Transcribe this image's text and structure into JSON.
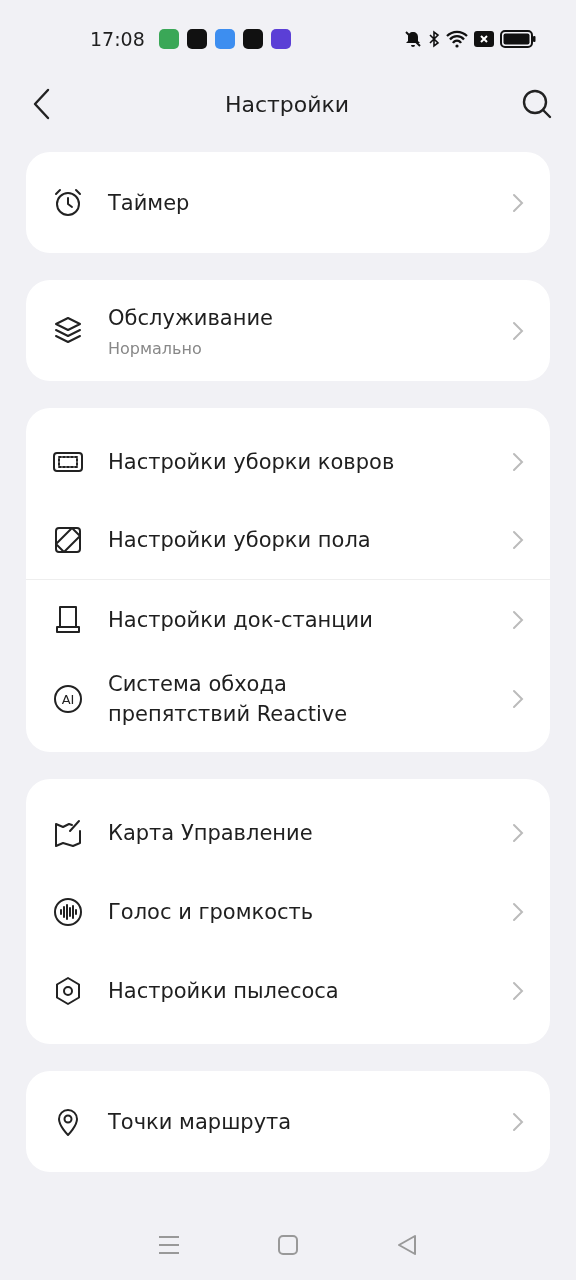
{
  "status_bar": {
    "time": "17:08",
    "app_icons": [
      {
        "color": "#3aa757"
      },
      {
        "color": "#111111"
      },
      {
        "color": "#3d8ef0"
      },
      {
        "color": "#111111"
      },
      {
        "color": "#5b3fd6"
      }
    ]
  },
  "header": {
    "title": "Настройки"
  },
  "groups": [
    {
      "items": [
        {
          "kind": "alarm",
          "label": "Таймер"
        }
      ]
    },
    {
      "items": [
        {
          "kind": "layers",
          "label": "Обслуживание",
          "subtitle": "Нормально"
        }
      ]
    },
    {
      "items": [
        {
          "kind": "carpet",
          "label": "Настройки уборки ковров"
        },
        {
          "kind": "floor",
          "label": "Настройки уборки пола",
          "divider": true
        },
        {
          "kind": "dock",
          "label": "Настройки док-станции"
        },
        {
          "kind": "ai",
          "icon_text": "AI",
          "label": "Система обхода препятствий Reactive"
        }
      ]
    },
    {
      "items": [
        {
          "kind": "map",
          "label": "Карта Управление"
        },
        {
          "kind": "voice",
          "label": "Голос и громкость"
        },
        {
          "kind": "hex",
          "label": "Настройки пылесоса"
        }
      ]
    },
    {
      "items": [
        {
          "kind": "pin",
          "label": "Точки маршрута"
        }
      ]
    }
  ]
}
